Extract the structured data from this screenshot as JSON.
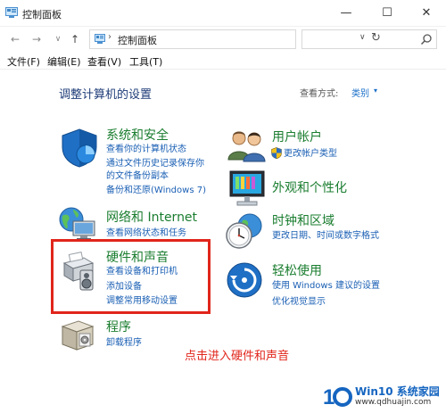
{
  "window": {
    "title": "控制面板",
    "minimize_glyph": "—",
    "maximize_glyph": "☐",
    "close_glyph": "✕"
  },
  "address_bar": {
    "separator": "›",
    "path": "控制面板",
    "dropdown_glyph": "∨",
    "refresh_glyph": "↻",
    "search_placeholder": ""
  },
  "nav": {
    "back_glyph": "←",
    "forward_glyph": "→",
    "recent_glyph": "∨",
    "up_glyph": "↑"
  },
  "menu": {
    "file": "文件(F)",
    "edit": "编辑(E)",
    "view": "查看(V)",
    "tools": "工具(T)"
  },
  "content": {
    "heading": "调整计算机的设置",
    "view_by_label": "查看方式:",
    "view_by_value": "类别",
    "view_by_caret": "▾"
  },
  "categories": {
    "system_security": {
      "title": "系统和安全",
      "links": [
        "查看你的计算机状态",
        "通过文件历史记录保存你",
        "的文件备份副本",
        "备份和还原(Windows 7)"
      ]
    },
    "network": {
      "title": "网络和 Internet",
      "links": [
        "查看网络状态和任务"
      ]
    },
    "hardware_sound": {
      "title": "硬件和声音",
      "links": [
        "查看设备和打印机",
        "添加设备",
        "调整常用移动设置"
      ]
    },
    "programs": {
      "title": "程序",
      "links": [
        "卸载程序"
      ]
    },
    "user_accounts": {
      "title": "用户帐户",
      "links": [
        "更改帐户类型"
      ]
    },
    "appearance": {
      "title": "外观和个性化",
      "links": []
    },
    "clock_region": {
      "title": "时钟和区域",
      "links": [
        "更改日期、时间或数字格式"
      ]
    },
    "ease_of_access": {
      "title": "轻松使用",
      "links": [
        "使用 Windows 建议的设置",
        "优化视觉显示"
      ]
    }
  },
  "annotation": {
    "text": "点击进入硬件和声音",
    "color": "#e1251b"
  },
  "watermark": {
    "title": "Win10 系统家园",
    "url": "www.qdhuajin.com"
  },
  "colors": {
    "category_title": "#1a7d2f",
    "link": "#1a5fb4",
    "heading": "#1e3c78",
    "highlight": "#e1251b"
  }
}
